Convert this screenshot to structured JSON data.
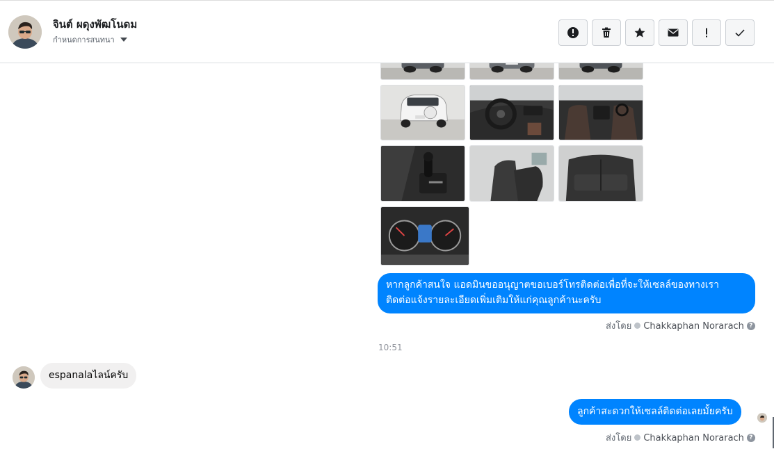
{
  "header": {
    "name": "จินต์ ผดุงพัฒโนดม",
    "sub_label": "กำหนดการสนทนา",
    "actions": [
      {
        "icon": "report-icon"
      },
      {
        "icon": "trash-icon"
      },
      {
        "icon": "star-icon"
      },
      {
        "icon": "envelope-icon"
      },
      {
        "icon": "exclamation-icon"
      },
      {
        "icon": "check-icon"
      }
    ]
  },
  "thumbnails": [
    {
      "label": "car-rear-top-1"
    },
    {
      "label": "car-rear-top-2"
    },
    {
      "label": "car-rear-top-3"
    },
    {
      "label": "car-rear-white-suv"
    },
    {
      "label": "steering-wheel"
    },
    {
      "label": "front-seats"
    },
    {
      "label": "gear-shifter"
    },
    {
      "label": "driver-seat"
    },
    {
      "label": "rear-seats"
    },
    {
      "label": "instrument-cluster"
    }
  ],
  "messages": {
    "out1_line1": "หากลูกค้าสนใจ แอดมินขออนุญาตขอเบอร์โทรติดต่อเพื่อที่จะให้เซลล์ของทางเรา",
    "out1_line2": "ติดต่อแจ้งรายละเอียดเพิ่มเติมให้แก่คุณลูกค้านะครับ",
    "sent_by_label": "ส่งโดย",
    "sender_name": "Chakkaphan Norarach",
    "help_glyph": "?",
    "timestamp": "10:51",
    "in1": "espanalaไลน์ครับ",
    "out2": "ลูกค้าสะดวกให้เซลล์ติดต่อเลยมั้ยครับ"
  },
  "colors": {
    "accent": "#0084ff",
    "incoming_bubble": "#f1f0f0"
  }
}
